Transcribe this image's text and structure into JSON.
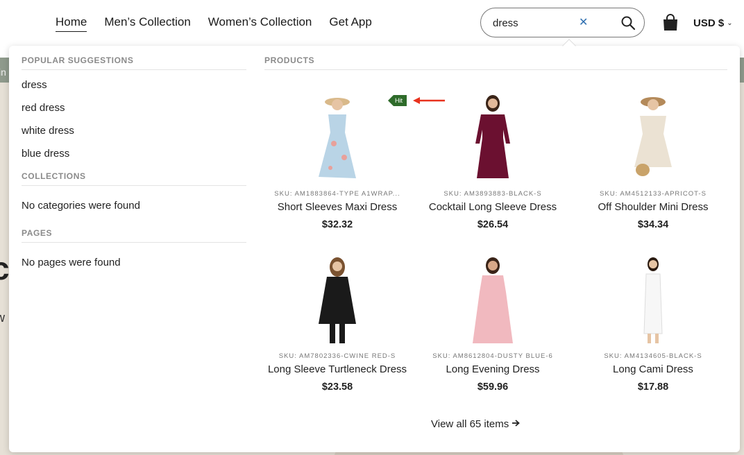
{
  "background": {
    "peek_text_a": "in",
    "peek_text_b": "ct",
    "peek_text_c": "w"
  },
  "header": {
    "nav": [
      {
        "label": "Home",
        "active": true
      },
      {
        "label": "Men’s Collection",
        "active": false
      },
      {
        "label": "Women’s Collection",
        "active": false
      },
      {
        "label": "Get App",
        "active": false
      }
    ],
    "search": {
      "value": "dress",
      "clear_icon": "close-icon",
      "button_icon": "search-icon"
    },
    "cart_icon": "shopping-bag-icon",
    "currency": "USD $"
  },
  "dropdown": {
    "popular": {
      "title": "POPULAR SUGGESTIONS",
      "items": [
        "dress",
        "red dress",
        "white dress",
        "blue dress"
      ]
    },
    "collections": {
      "title": "COLLECTIONS",
      "empty": "No categories were found"
    },
    "pages": {
      "title": "PAGES",
      "empty": "No pages were found"
    },
    "products": {
      "title": "PRODUCTS",
      "badge": "Hit",
      "items": [
        {
          "sku": "SKU: AM1883864-TYPE A1WRAP...",
          "name": "Short Sleeves Maxi Dress",
          "price": "$32.32",
          "color": "#b9d4e6"
        },
        {
          "sku": "SKU: AM3893883-BLACK-S",
          "name": "Cocktail Long Sleeve Dress",
          "price": "$26.54",
          "color": "#6b1030"
        },
        {
          "sku": "SKU: AM4512133-APRICOT-S",
          "name": "Off Shoulder Mini Dress",
          "price": "$34.34",
          "color": "#ebe2d3"
        },
        {
          "sku": "SKU: AM7802336-CWINE RED-S",
          "name": "Long Sleeve Turtleneck Dress",
          "price": "$23.58",
          "color": "#1a1a1a"
        },
        {
          "sku": "SKU: AM8612804-DUSTY BLUE-6",
          "name": "Long Evening Dress",
          "price": "$59.96",
          "color": "#f1b9bf"
        },
        {
          "sku": "SKU: AM4134605-BLACK-S",
          "name": "Long Cami Dress",
          "price": "$17.88",
          "color": "#f7f7f7"
        }
      ],
      "view_all": "View all 65 items"
    }
  },
  "colors": {
    "badge": "#2e6b2a",
    "arrow": "#e8321e",
    "clear": "#2f6fb0"
  }
}
